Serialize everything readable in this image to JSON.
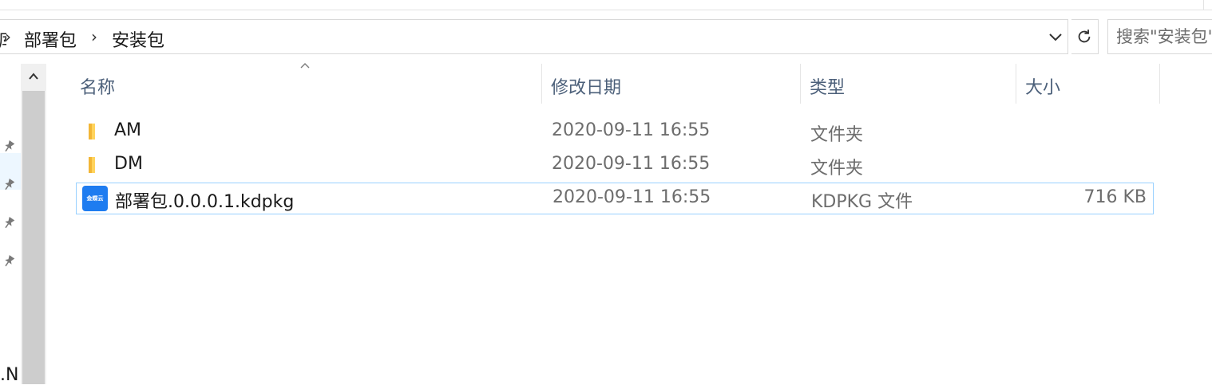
{
  "address_bar": {
    "breadcrumb": [
      "部署包",
      "安装包"
    ],
    "cut_left_text": "库"
  },
  "search": {
    "placeholder": "搜索\"安装包\""
  },
  "columns": {
    "name": "名称",
    "date": "修改日期",
    "type": "类型",
    "size": "大小"
  },
  "files": [
    {
      "name": "AM",
      "date": "2020-09-11 16:55",
      "type": "文件夹",
      "size": "",
      "icon": "folder-icon"
    },
    {
      "name": "DM",
      "date": "2020-09-11 16:55",
      "type": "文件夹",
      "size": "",
      "icon": "folder-icon"
    },
    {
      "name": "部署包.0.0.0.1.kdpkg",
      "date": "2020-09-11 16:55",
      "type": "KDPKG 文件",
      "size": "716 KB",
      "icon": "kingdee-app-icon",
      "icon_text": "金蝶云"
    }
  ],
  "nav": {
    "cut_text": ".N"
  },
  "colors": {
    "header_text": "#4c607a",
    "selected_border": "#99d1ff",
    "folder": "#ffd35c",
    "app_icon": "#1e7cf0"
  }
}
